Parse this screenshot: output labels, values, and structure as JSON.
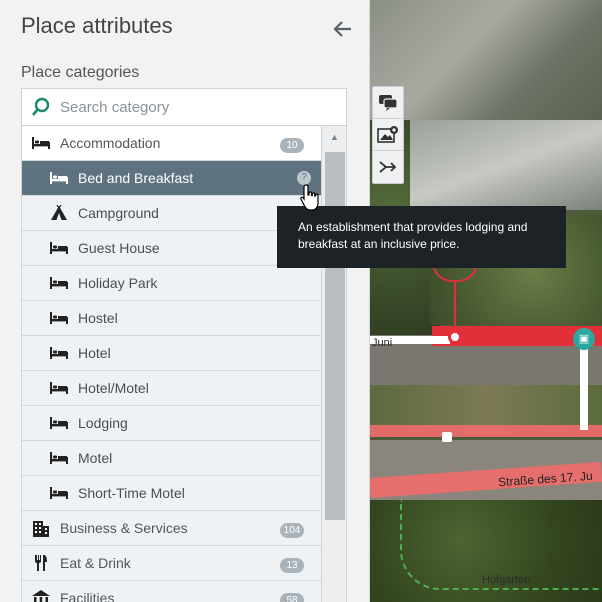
{
  "panel": {
    "title": "Place attributes",
    "back_icon": "arrow-left-icon",
    "section_label": "Place categories",
    "search_placeholder": "Search category"
  },
  "categories": [
    {
      "label": "Accommodation",
      "count": "10",
      "icon": "bed-icon",
      "type": "parent"
    },
    {
      "label": "Bed and Breakfast",
      "icon": "bed-icon",
      "type": "child",
      "selected": true,
      "info": "?"
    },
    {
      "label": "Campground",
      "icon": "tent-icon",
      "type": "child"
    },
    {
      "label": "Guest House",
      "icon": "bed-icon",
      "type": "child"
    },
    {
      "label": "Holiday Park",
      "icon": "bed-icon",
      "type": "child"
    },
    {
      "label": "Hostel",
      "icon": "bed-icon",
      "type": "child"
    },
    {
      "label": "Hotel",
      "icon": "bed-icon",
      "type": "child"
    },
    {
      "label": "Hotel/Motel",
      "icon": "bed-icon",
      "type": "child"
    },
    {
      "label": "Lodging",
      "icon": "bed-icon",
      "type": "child"
    },
    {
      "label": "Motel",
      "icon": "bed-icon",
      "type": "child"
    },
    {
      "label": "Short-Time Motel",
      "icon": "bed-icon",
      "type": "child"
    },
    {
      "label": "Business & Services",
      "count": "104",
      "icon": "building-icon",
      "type": "parent"
    },
    {
      "label": "Eat & Drink",
      "count": "13",
      "icon": "fork-knife-icon",
      "type": "parent"
    },
    {
      "label": "Facilities",
      "count": "58",
      "icon": "facility-icon",
      "type": "parent"
    }
  ],
  "tooltip": {
    "text": "An establishment that provides lodging and breakfast at an inclusive price."
  },
  "map": {
    "labels": [
      "Juni",
      "Straße des 17. Ju",
      "Hofgarten"
    ],
    "tools": [
      "comment-icon",
      "add-image-icon",
      "merge-icon"
    ]
  },
  "colors": {
    "selected_row": "#5e7280",
    "search_icon": "#1a8a6b",
    "tooltip_bg": "#1d2227",
    "road_red": "#e2303b"
  }
}
